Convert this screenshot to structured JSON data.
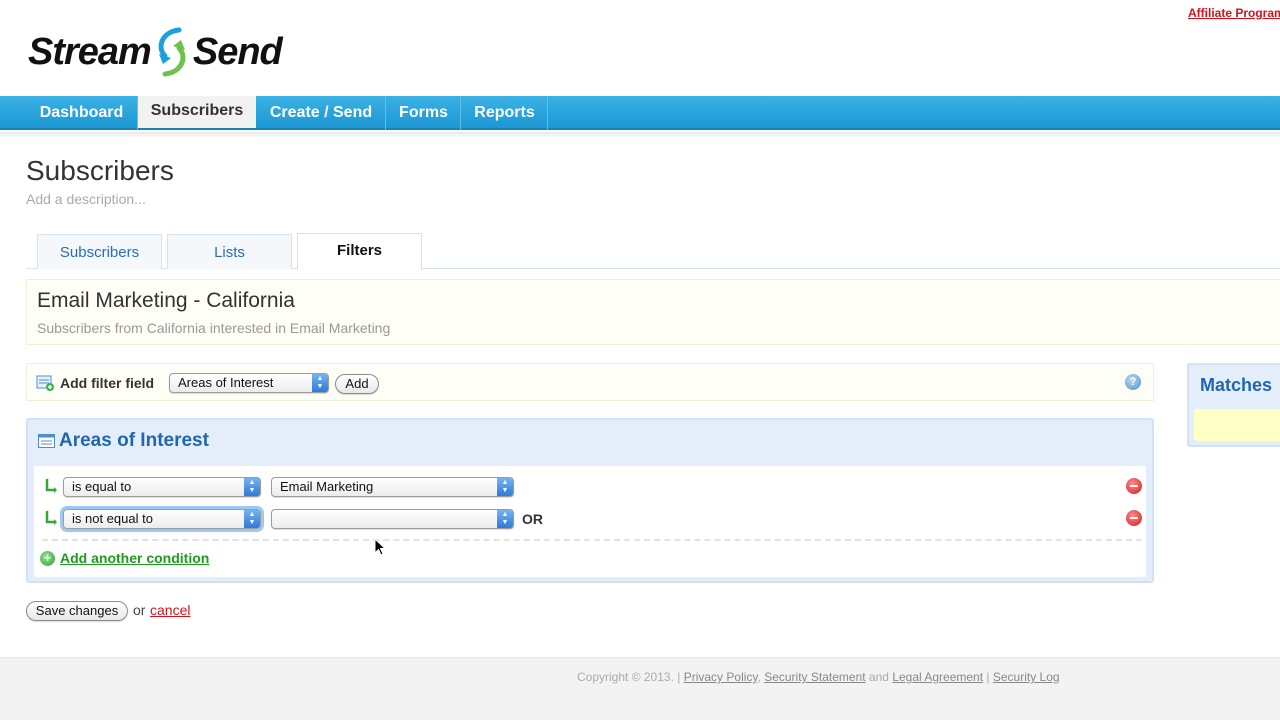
{
  "header": {
    "affiliate_link": "Affiliate Program",
    "logo_left": "Stream",
    "logo_right": "Send"
  },
  "nav": {
    "items": [
      {
        "label": "Dashboard"
      },
      {
        "label": "Subscribers",
        "active": true
      },
      {
        "label": "Create / Send"
      },
      {
        "label": "Forms"
      },
      {
        "label": "Reports"
      }
    ]
  },
  "page": {
    "title": "Subscribers",
    "description_placeholder": "Add a description..."
  },
  "tabs": [
    {
      "label": "Subscribers"
    },
    {
      "label": "Lists"
    },
    {
      "label": "Filters",
      "active": true
    }
  ],
  "filter": {
    "name": "Email Marketing - California",
    "description": "Subscribers from California interested in Email Marketing"
  },
  "add_filter": {
    "label": "Add filter field",
    "selected_field": "Areas of Interest",
    "add_button": "Add",
    "help_icon": "?"
  },
  "panel": {
    "title": "Areas of Interest",
    "conditions": [
      {
        "operator": "is equal to",
        "value": "Email Marketing",
        "joiner": ""
      },
      {
        "operator": "is not equal to",
        "value": "",
        "joiner": "OR"
      }
    ],
    "add_condition": "Add another condition"
  },
  "actions": {
    "save": "Save changes",
    "or": "or",
    "cancel": "cancel"
  },
  "matches": {
    "title": "Matches"
  },
  "footer": {
    "copyright": "Copyright © 2013.",
    "sep1": "|",
    "privacy": "Privacy Policy",
    "comma": ",",
    "security": "Security Statement",
    "and": "and",
    "legal": "Legal Agreement",
    "sep2": "|",
    "security_log": "Security Log"
  },
  "colors": {
    "nav_blue": "#1c97d2",
    "link_red": "#d4121c",
    "panel_title_blue": "#2067b0",
    "add_green": "#1f9b1f"
  }
}
